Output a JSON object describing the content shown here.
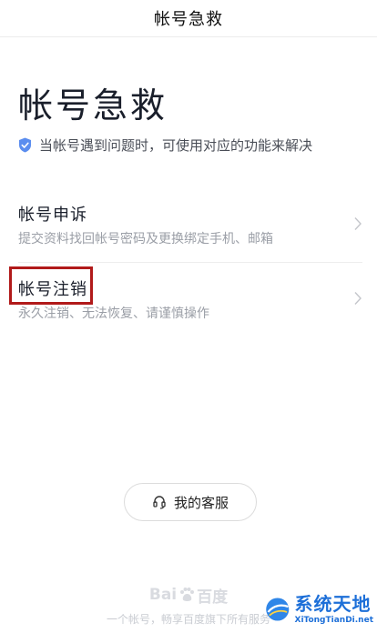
{
  "header": {
    "title": "帐号急救"
  },
  "hero": {
    "title": "帐号急救",
    "subtitle": "当帐号遇到问题时，可使用对应的功能来解决"
  },
  "options": [
    {
      "name": "帐号申诉",
      "desc": "提交资料找回帐号密码及更换绑定手机、邮箱"
    },
    {
      "name": "帐号注销",
      "desc": "永久注销、无法恢复、请谨慎操作"
    }
  ],
  "service": {
    "label": "我的客服"
  },
  "footer": {
    "logo_left": "Bai",
    "logo_right": "百度",
    "text": "一个帐号，畅享百度旗下所有服务"
  },
  "watermark": {
    "cn": "系统天地",
    "en": "XiTongTianDi.net"
  },
  "colors": {
    "accent": "#4a7be8",
    "highlight": "#b11a1a",
    "watermark": "#1d6fd8"
  }
}
